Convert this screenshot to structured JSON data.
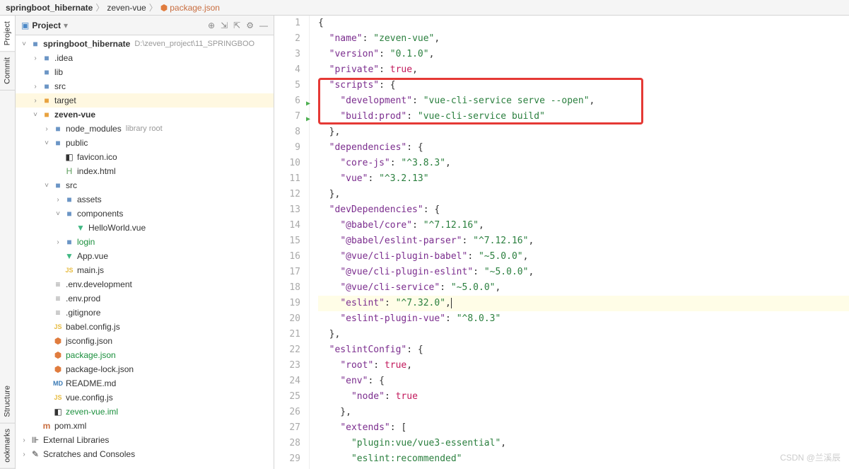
{
  "breadcrumb": {
    "items": [
      "springboot_hibernate",
      "zeven-vue",
      "package.json"
    ]
  },
  "sidebar_tabs": {
    "project": "Project",
    "commit": "Commit",
    "structure": "Structure",
    "bookmarks": "ookmarks"
  },
  "project_header": {
    "title": "Project"
  },
  "tree": {
    "root": {
      "label": "springboot_hibernate",
      "meta": "D:\\zeven_project\\11_SPRINGBOO"
    },
    "idea": ".idea",
    "lib": "lib",
    "src": "src",
    "target": "target",
    "zeven_vue": "zeven-vue",
    "node_modules": {
      "label": "node_modules",
      "meta": "library root"
    },
    "public": "public",
    "favicon": "favicon.ico",
    "index_html": "index.html",
    "src2": "src",
    "assets": "assets",
    "components": "components",
    "hello_world": "HelloWorld.vue",
    "login": "login",
    "app_vue": "App.vue",
    "main_js": "main.js",
    "env_dev": ".env.development",
    "env_prod": ".env.prod",
    "gitignore": ".gitignore",
    "babel_config": "babel.config.js",
    "jsconfig": "jsconfig.json",
    "package_json": "package.json",
    "package_lock": "package-lock.json",
    "readme": "README.md",
    "vue_config": "vue.config.js",
    "zeven_vue_iml": "zeven-vue.iml",
    "pom_xml": "pom.xml",
    "ext_libs": "External Libraries",
    "scratches": "Scratches and Consoles"
  },
  "code": {
    "line1": "{",
    "line2_k": "\"name\"",
    "line2_v": "\"zeven-vue\"",
    "line3_k": "\"version\"",
    "line3_v": "\"0.1.0\"",
    "line4_k": "\"private\"",
    "line4_v": "true",
    "line5_k": "\"scripts\"",
    "line6_k": "\"development\"",
    "line6_v": "\"vue-cli-service serve --open\"",
    "line7_k": "\"build:prod\"",
    "line7_v": "\"vue-cli-service build\"",
    "line8": "  },",
    "line9_k": "\"dependencies\"",
    "line10_k": "\"core-js\"",
    "line10_v": "\"^3.8.3\"",
    "line11_k": "\"vue\"",
    "line11_v": "\"^3.2.13\"",
    "line12": "  },",
    "line13_k": "\"devDependencies\"",
    "line14_k": "\"@babel/core\"",
    "line14_v": "\"^7.12.16\"",
    "line15_k": "\"@babel/eslint-parser\"",
    "line15_v": "\"^7.12.16\"",
    "line16_k": "\"@vue/cli-plugin-babel\"",
    "line16_v": "\"~5.0.0\"",
    "line17_k": "\"@vue/cli-plugin-eslint\"",
    "line17_v": "\"~5.0.0\"",
    "line18_k": "\"@vue/cli-service\"",
    "line18_v": "\"~5.0.0\"",
    "line19_k": "\"eslint\"",
    "line19_v": "\"^7.32.0\"",
    "line20_k": "\"eslint-plugin-vue\"",
    "line20_v": "\"^8.0.3\"",
    "line21": "  },",
    "line22_k": "\"eslintConfig\"",
    "line23_k": "\"root\"",
    "line23_v": "true",
    "line24_k": "\"env\"",
    "line25_k": "\"node\"",
    "line25_v": "true",
    "line26": "    },",
    "line27_k": "\"extends\"",
    "line28_v": "\"plugin:vue/vue3-essential\"",
    "line29_v": "\"eslint:recommended\""
  },
  "line_numbers": [
    "1",
    "2",
    "3",
    "4",
    "5",
    "6",
    "7",
    "8",
    "9",
    "10",
    "11",
    "12",
    "13",
    "14",
    "15",
    "16",
    "17",
    "18",
    "19",
    "20",
    "21",
    "22",
    "23",
    "24",
    "25",
    "26",
    "27",
    "28",
    "29"
  ],
  "watermark": "CSDN @兰溪辰"
}
